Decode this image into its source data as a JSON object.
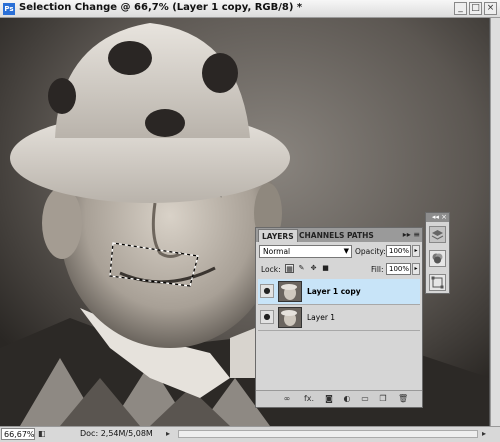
{
  "window": {
    "app_icon": "Ps",
    "title": "Selection Change @ 66,7% (Layer 1 copy, RGB/8) *",
    "controls": [
      "_",
      "□",
      "×"
    ]
  },
  "status": {
    "zoom": "66,67%",
    "doc": "Doc: 2,54M/5,08M"
  },
  "layers_panel": {
    "tabs": [
      "LAYERS",
      "CHANNELS",
      "PATHS"
    ],
    "menu_glyph": "▸▸ ≡",
    "blend_mode": "Normal",
    "opacity_label": "Opacity:",
    "opacity_value": "100%",
    "lock_label": "Lock:",
    "fill_label": "Fill:",
    "fill_value": "100%",
    "layers": [
      {
        "name": "Layer 1 copy",
        "selected": true
      },
      {
        "name": "Layer 1",
        "selected": false
      }
    ],
    "footer_icons": [
      "link-icon",
      "fx-icon",
      "mask-icon",
      "adjustment-icon",
      "group-icon",
      "new-layer-icon",
      "trash-icon"
    ],
    "footer_glyphs": [
      "∞",
      "fx.",
      "◙",
      "◐",
      "▭",
      "❐",
      "🗑"
    ]
  },
  "side_strip": {
    "top_glyph": "◂◂ ×",
    "icons": [
      "layers-icon",
      "channels-icon",
      "transform-icon"
    ]
  }
}
